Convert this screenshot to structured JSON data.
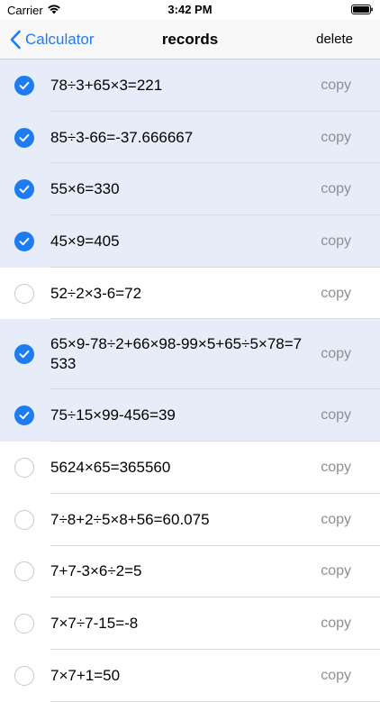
{
  "status": {
    "carrier": "Carrier",
    "time": "3:42 PM"
  },
  "nav": {
    "back_label": "Calculator",
    "title": "records",
    "delete_label": "delete"
  },
  "copy_label": "copy",
  "records": [
    {
      "expr": "78÷3+65×3=221",
      "checked": true
    },
    {
      "expr": "85÷3-66=-37.666667",
      "checked": true
    },
    {
      "expr": "55×6=330",
      "checked": true
    },
    {
      "expr": "45×9=405",
      "checked": true
    },
    {
      "expr": "52÷2×3-6=72",
      "checked": false
    },
    {
      "expr": "65×9-78÷2+66×98-99×5+65÷5×78=7533",
      "checked": true,
      "tall": true
    },
    {
      "expr": "75÷15×99-456=39",
      "checked": true
    },
    {
      "expr": "5624×65=365560",
      "checked": false
    },
    {
      "expr": "7÷8+2÷5×8+56=60.075",
      "checked": false
    },
    {
      "expr": "7+7-3×6÷2=5",
      "checked": false
    },
    {
      "expr": "7×7÷7-15=-8",
      "checked": false
    },
    {
      "expr": "7×7+1=50",
      "checked": false
    }
  ]
}
